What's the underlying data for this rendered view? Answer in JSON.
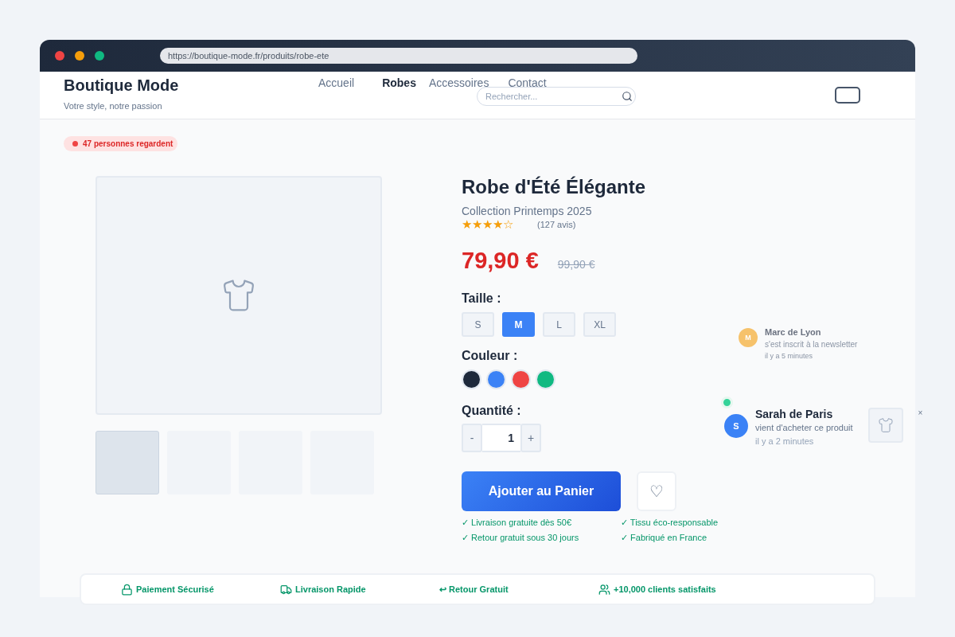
{
  "browser": {
    "url": "https://boutique-mode.fr/produits/robe-ete"
  },
  "header": {
    "brand": "Boutique Mode",
    "tagline": "Votre style, notre passion",
    "nav": [
      {
        "label": "Accueil",
        "selected": false
      },
      {
        "label": "Robes",
        "selected": true
      },
      {
        "label": "Accessoires",
        "selected": false
      },
      {
        "label": "Contact",
        "selected": false
      }
    ],
    "search": {
      "placeholder": "Rechercher..."
    }
  },
  "viewers_badge": "47 personnes regardent",
  "gallery": {
    "thumbnails": [
      {
        "selected": true
      },
      {
        "selected": false
      },
      {
        "selected": false
      },
      {
        "selected": false
      }
    ]
  },
  "product": {
    "title": "Robe d'Été Élégante",
    "collection": "Collection Printemps 2025",
    "stars": 4,
    "reviews": "(127 avis)",
    "price": "79,90 €",
    "old_price": "99,90 €",
    "size_label": "Taille :",
    "sizes": [
      {
        "label": "S",
        "selected": false
      },
      {
        "label": "M",
        "selected": true
      },
      {
        "label": "L",
        "selected": false
      },
      {
        "label": "XL",
        "selected": false
      }
    ],
    "color_label": "Couleur :",
    "colors": [
      {
        "color": "#1e293b"
      },
      {
        "color": "#3b82f6"
      },
      {
        "color": "#ef4444"
      },
      {
        "color": "#10b981"
      }
    ],
    "quantity_label": "Quantité :",
    "quantity": {
      "minus": "-",
      "value": "1",
      "plus": "+"
    },
    "add_to_cart": "Ajouter au Panier",
    "wishlist": "♡",
    "perks": [
      "✓ Livraison gratuite dès 50€",
      "✓ Tissu éco-responsable",
      "✓ Retour gratuit sous 30 jours",
      "✓ Fabriqué en France"
    ]
  },
  "notifications": [
    {
      "initial": "M",
      "name": "Marc de Lyon",
      "message": "s'est inscrit à la newsletter",
      "time": "il y a 5 minutes",
      "color": "#f6c26b",
      "faded": true
    },
    {
      "initial": "S",
      "name": "Sarah de Paris",
      "message": "vient d'acheter ce produit",
      "time": "il y a 2 minutes",
      "color": "#3b82f6",
      "faded": false,
      "close": "×"
    }
  ],
  "trust_bar": [
    "Paiement Sécurisé",
    "Livraison Rapide",
    "↩ Retour Gratuit",
    "+10,000 clients satisfaits"
  ]
}
